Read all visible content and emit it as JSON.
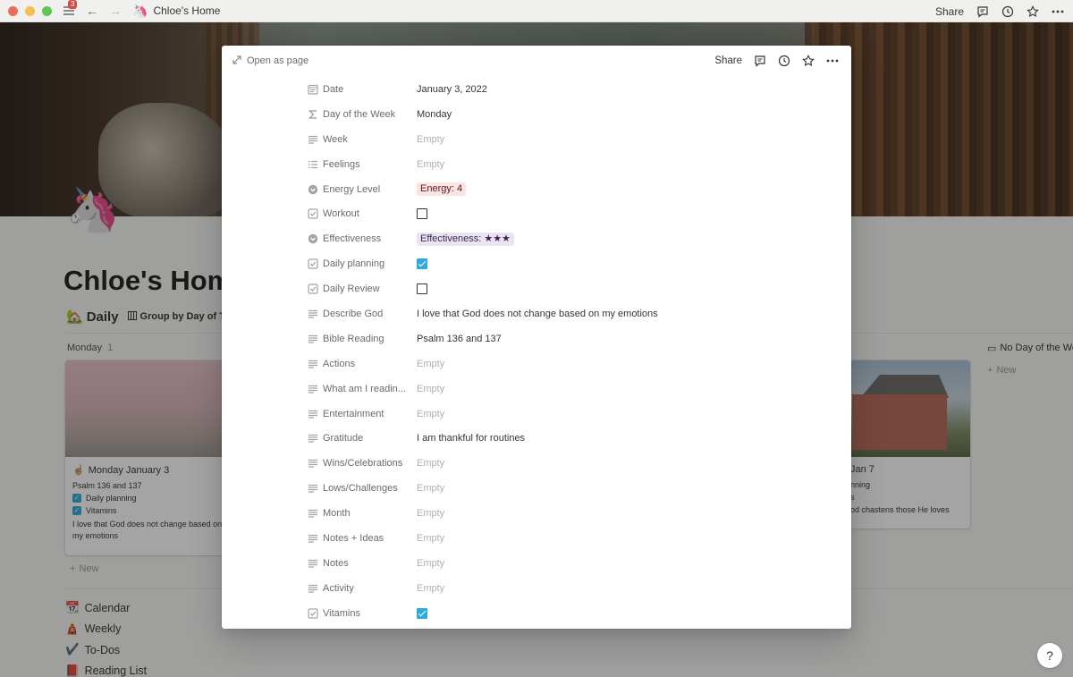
{
  "titlebar": {
    "notification_count": "3",
    "page_icon": "🦄",
    "title": "Chloe's Home",
    "share": "Share"
  },
  "background_page": {
    "page_icon": "🦄",
    "title": "Chloe's Home",
    "view_icon": "🏡",
    "view_name": "Daily",
    "group_by": "Group by Day of Th",
    "group": {
      "name": "Monday",
      "count": "1"
    },
    "card": {
      "icon": "☝🏼",
      "title": "Monday January 3",
      "bible": "Psalm 136 and 137",
      "check1": "Daily planning",
      "check2": "Vitamins",
      "describe": "I love that God does not change based on my emotions"
    },
    "card2": {
      "title": "Jan 7",
      "line1": "nning",
      "line2": "s",
      "line3": "od chastens those He loves"
    },
    "new_label": "New",
    "no_day_group": "No Day of the We",
    "new_label2": "New",
    "links": [
      {
        "icon": "📆",
        "label": "Calendar"
      },
      {
        "icon": "🛕",
        "label": "Weekly"
      },
      {
        "icon": "✔️",
        "label": "To-Dos"
      },
      {
        "icon": "📕",
        "label": "Reading List"
      }
    ],
    "help": "?"
  },
  "modal": {
    "open_as_page": "Open as page",
    "share": "Share",
    "properties": [
      {
        "icon": "calendar-icon",
        "name": "Date",
        "value": "January 3, 2022",
        "type": "text"
      },
      {
        "icon": "sigma-icon",
        "name": "Day of the Week",
        "value": "Monday",
        "type": "text"
      },
      {
        "icon": "text-icon",
        "name": "Week",
        "value": "Empty",
        "type": "empty"
      },
      {
        "icon": "list-icon",
        "name": "Feelings",
        "value": "Empty",
        "type": "empty"
      },
      {
        "icon": "select-icon",
        "name": "Energy Level",
        "value": "Energy: 4",
        "type": "tag",
        "color": "#fbe4e4"
      },
      {
        "icon": "checkbox-icon",
        "name": "Workout",
        "value": "unchecked",
        "type": "checkbox"
      },
      {
        "icon": "select-icon",
        "name": "Effectiveness",
        "value": "Effectiveness: ★★★",
        "type": "tag",
        "color": "#eae4f2"
      },
      {
        "icon": "checkbox-icon",
        "name": "Daily planning",
        "value": "checked",
        "type": "checkbox"
      },
      {
        "icon": "checkbox-icon",
        "name": "Daily Review",
        "value": "unchecked",
        "type": "checkbox"
      },
      {
        "icon": "text-icon",
        "name": "Describe God",
        "value": "I love that God does not change based on my emotions",
        "type": "text"
      },
      {
        "icon": "text-icon",
        "name": "Bible Reading",
        "value": "Psalm 136 and 137",
        "type": "text"
      },
      {
        "icon": "text-icon",
        "name": "Actions",
        "value": "Empty",
        "type": "empty"
      },
      {
        "icon": "text-icon",
        "name": "What am I readin...",
        "value": "Empty",
        "type": "empty"
      },
      {
        "icon": "text-icon",
        "name": "Entertainment",
        "value": "Empty",
        "type": "empty"
      },
      {
        "icon": "text-icon",
        "name": "Gratitude",
        "value": "I am thankful for routines",
        "type": "text"
      },
      {
        "icon": "text-icon",
        "name": "Wins/Celebrations",
        "value": "Empty",
        "type": "empty"
      },
      {
        "icon": "text-icon",
        "name": "Lows/Challenges",
        "value": "Empty",
        "type": "empty"
      },
      {
        "icon": "text-icon",
        "name": "Month",
        "value": "Empty",
        "type": "empty"
      },
      {
        "icon": "text-icon",
        "name": "Notes + Ideas",
        "value": "Empty",
        "type": "empty"
      },
      {
        "icon": "text-icon",
        "name": "Notes",
        "value": "Empty",
        "type": "empty"
      },
      {
        "icon": "text-icon",
        "name": "Activity",
        "value": "Empty",
        "type": "empty"
      },
      {
        "icon": "checkbox-icon",
        "name": "Vitamins",
        "value": "checked",
        "type": "checkbox"
      }
    ]
  },
  "colors": {
    "accent": "#2eaadc",
    "energy_tag": "#fbe4e4",
    "effectiveness_tag": "#eae4f2"
  }
}
